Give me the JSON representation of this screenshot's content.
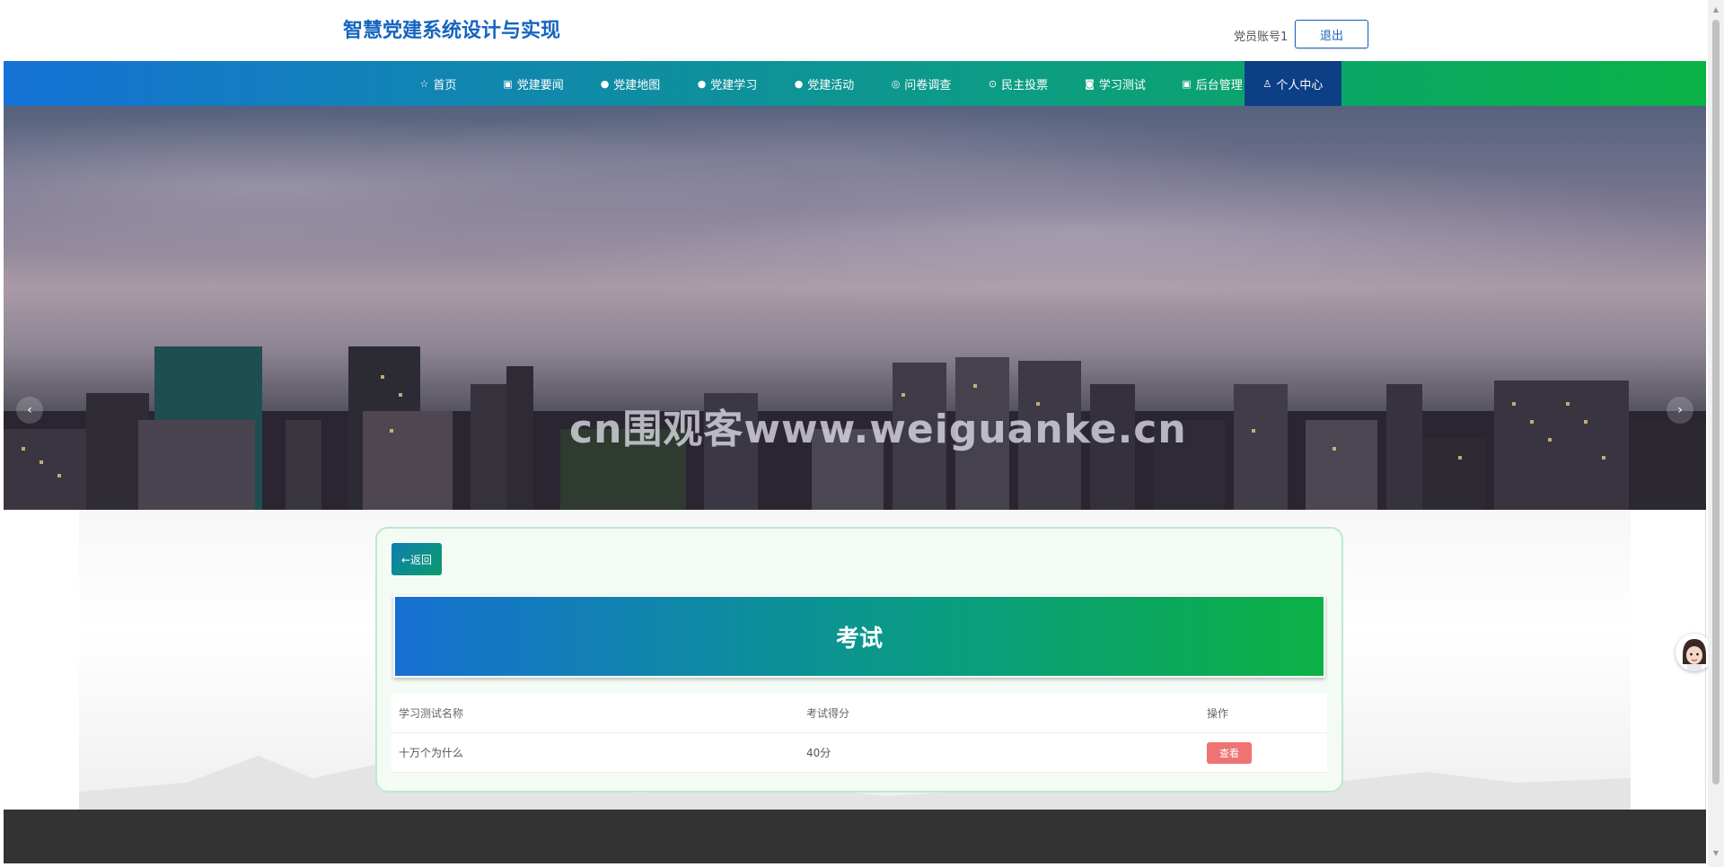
{
  "header": {
    "site_title": "智慧党建系统设计与实现",
    "account_label": "党员账号1",
    "logout_label": "退出"
  },
  "nav": {
    "items": [
      {
        "label": "首页",
        "icon": "star-icon",
        "glyph": "☆"
      },
      {
        "label": "党建要闻",
        "icon": "bag-icon",
        "glyph": "🛍"
      },
      {
        "label": "党建地图",
        "icon": "info-icon",
        "glyph": "ℹ"
      },
      {
        "label": "党建学习",
        "icon": "question-icon",
        "glyph": "?"
      },
      {
        "label": "党建活动",
        "icon": "info-circle-icon",
        "glyph": "ℹ"
      },
      {
        "label": "问卷调查",
        "icon": "target-icon",
        "glyph": "◎"
      },
      {
        "label": "民主投票",
        "icon": "check-circle-icon",
        "glyph": "✓"
      },
      {
        "label": "学习测试",
        "icon": "camera-icon",
        "glyph": "◙"
      },
      {
        "label": "后台管理",
        "icon": "box-icon",
        "glyph": "▣"
      },
      {
        "label": "个人中心",
        "icon": "user-icon",
        "glyph": "♙"
      }
    ],
    "active_index": 9
  },
  "banner": {
    "watermark": "cn围观客www.weiguanke.cn",
    "prev_icon": "chevron-left-icon",
    "next_icon": "chevron-right-icon",
    "active_slide": 1,
    "slide_count": 3
  },
  "main": {
    "back_label": "←返回",
    "exam_title": "考试",
    "table": {
      "headers": [
        "学习测试名称",
        "考试得分",
        "操作"
      ],
      "rows": [
        {
          "name": "十万个为什么",
          "score": "40分",
          "action": "查看"
        }
      ]
    }
  },
  "colors": {
    "brand": "#1565c0",
    "nav_start": "#1572d6",
    "nav_end": "#0ab246",
    "active_nav": "#0d3f86",
    "view_button": "#f07373",
    "footer": "#333333"
  }
}
